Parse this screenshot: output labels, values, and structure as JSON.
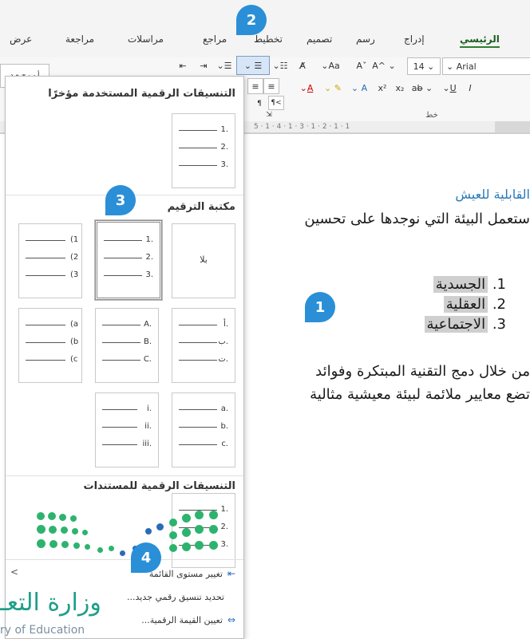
{
  "tabs": [
    "عرض",
    "مراجعة",
    "مراسلات",
    "مراجع",
    "تخطيط",
    "تصميم",
    "رسم",
    "إدراج",
    "الرئيسي"
  ],
  "ribbon": {
    "font_name": "Arial",
    "font_size": "14",
    "aa_label": "Aa",
    "group_label": "خط",
    "style_box_text": "أ ب ج ه د"
  },
  "ruler_text": "5 · 1 · 4 · 1 · 3 · 1 · 2 · 1 · 1",
  "document": {
    "heading": "القابلية للعيش",
    "line1": "ستعمل البيئة التي نوجدها على تحسين",
    "list": [
      {
        "num": "1.",
        "text": "الجسدية"
      },
      {
        "num": "2.",
        "text": "العقلية"
      },
      {
        "num": "3.",
        "text": "الاجتماعية"
      }
    ],
    "line2": "من خلال دمج التقنية المبتكرة وفوائد",
    "line3": "تضع معايير ملائمة لبيئة معيشية مثالية"
  },
  "panel": {
    "recent_title": "التنسيقات الرقمية المستخدمة مؤخرًا",
    "library_title": "مكتبة الترقيم",
    "document_title": "التنسيقات الرقمية للمستندات",
    "none_label": "بلا",
    "recent_format": [
      "1.",
      "2.",
      "3."
    ],
    "library": [
      {
        "markers": [],
        "none": true
      },
      {
        "markers": [
          "1.",
          "2.",
          "3."
        ],
        "selected": true
      },
      {
        "markers": [
          "(1",
          "(2",
          "(3"
        ]
      },
      {
        "markers": [
          "أ.",
          "ب.",
          "ت."
        ]
      },
      {
        "markers": [
          "A.",
          "B.",
          "C."
        ]
      },
      {
        "markers": [
          "(a",
          "(b",
          "(c"
        ]
      },
      {
        "markers": [
          "a.",
          "b.",
          "c."
        ]
      },
      {
        "markers": [
          "i.",
          "ii.",
          "iii."
        ]
      }
    ],
    "document_format": [
      "1.",
      "2.",
      "3."
    ],
    "menu": [
      {
        "label": "تغيير مستوى القائمة",
        "icon": "change-list-level-icon"
      },
      {
        "label": "تحديد تنسيق رقمي جديد...",
        "icon": ""
      },
      {
        "label": "تعيين القيمة الرقمية...",
        "icon": "set-numbering-value-icon"
      }
    ]
  },
  "callouts": [
    "1",
    "2",
    "3",
    "4"
  ],
  "logo": {
    "arabic": "وزارة التعـ",
    "english": "ry of Education"
  },
  "colors": {
    "accent": "#2a8fd6",
    "heading": "#2a7ab8",
    "logo_green": "#1f9e8a",
    "logo_blue": "#2a6bb8"
  }
}
